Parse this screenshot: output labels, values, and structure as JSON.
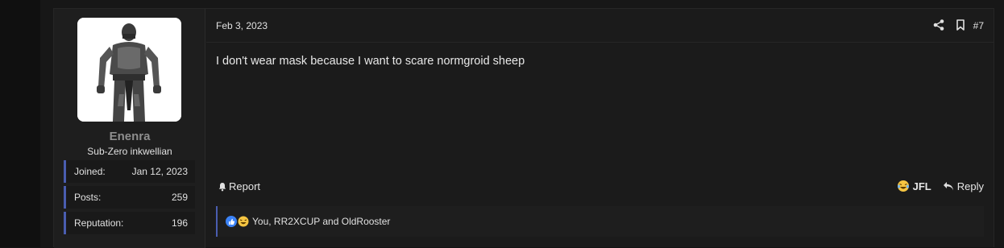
{
  "post": {
    "date": "Feb 3, 2023",
    "number": "#7",
    "message": "I don't wear mask because I want to scare normgroid sheep",
    "icons": {
      "share": "share-icon",
      "bookmark": "bookmark-icon"
    }
  },
  "user": {
    "name": "Enenra",
    "title": "Sub-Zero inkwellian",
    "stats": [
      {
        "label": "Joined:",
        "value": "Jan 12, 2023"
      },
      {
        "label": "Posts:",
        "value": "259"
      },
      {
        "label": "Reputation:",
        "value": "196"
      }
    ]
  },
  "actions": {
    "report": "Report",
    "react": "JFL",
    "reply": "Reply"
  },
  "reactions": {
    "text": "You, RR2XCUP and OldRooster",
    "icons": [
      "like-icon",
      "laugh-icon"
    ]
  },
  "colors": {
    "accent": "#4a5db0",
    "background": "#1b1b1b",
    "username": "#8e8e8e"
  }
}
